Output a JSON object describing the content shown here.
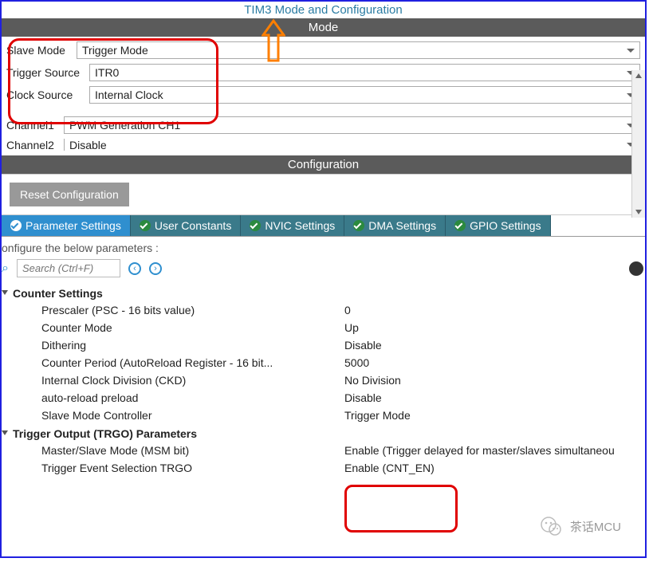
{
  "title": "TIM3 Mode and Configuration",
  "sections": {
    "mode": "Mode",
    "configuration": "Configuration"
  },
  "mode_fields": {
    "slave_mode": {
      "label": "Slave Mode",
      "value": "Trigger Mode"
    },
    "trigger_source": {
      "label": "Trigger Source",
      "value": "ITR0"
    },
    "clock_source": {
      "label": "Clock Source",
      "value": "Internal Clock"
    },
    "channel1": {
      "label": "Channel1",
      "value": "PWM Generation CH1"
    },
    "channel2": {
      "label": "Channel2",
      "value": "Disable"
    }
  },
  "buttons": {
    "reset": "Reset Configuration"
  },
  "tabs": [
    {
      "label": "Parameter Settings",
      "active": true
    },
    {
      "label": "User Constants",
      "active": false
    },
    {
      "label": "NVIC Settings",
      "active": false
    },
    {
      "label": "DMA Settings",
      "active": false
    },
    {
      "label": "GPIO Settings",
      "active": false
    }
  ],
  "config_description": "onfigure the below parameters :",
  "search": {
    "placeholder": "Search (Ctrl+F)"
  },
  "groups": [
    {
      "name": "Counter Settings",
      "rows": [
        {
          "label": "Prescaler (PSC - 16 bits value)",
          "value": "0"
        },
        {
          "label": "Counter Mode",
          "value": "Up"
        },
        {
          "label": "Dithering",
          "value": "Disable"
        },
        {
          "label": "Counter Period (AutoReload Register - 16 bit...",
          "value": "5000"
        },
        {
          "label": "Internal Clock Division (CKD)",
          "value": "No Division"
        },
        {
          "label": "auto-reload preload",
          "value": "Disable"
        },
        {
          "label": "Slave Mode Controller",
          "value": "Trigger Mode"
        }
      ]
    },
    {
      "name": "Trigger Output (TRGO) Parameters",
      "rows": [
        {
          "label": "Master/Slave Mode (MSM bit)",
          "value": "Enable (Trigger delayed for master/slaves simultaneou"
        },
        {
          "label": "Trigger Event Selection TRGO",
          "value": "Enable (CNT_EN)"
        }
      ]
    }
  ],
  "watermark": "茶话MCU"
}
